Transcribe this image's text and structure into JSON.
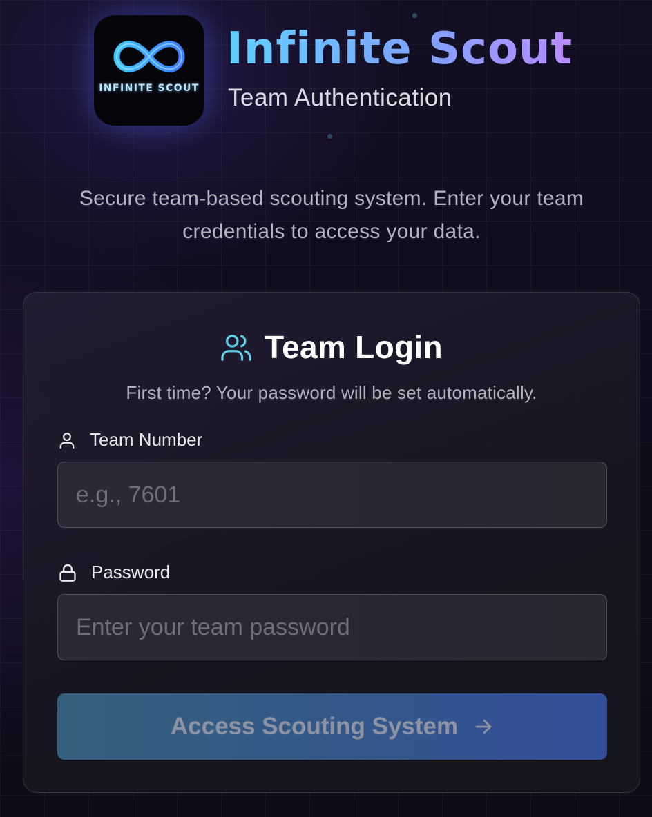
{
  "brand": {
    "logo_text": "INFINITE SCOUT",
    "title": "Infinite Scout",
    "subtitle": "Team Authentication"
  },
  "tagline": "Secure team-based scouting system. Enter your team credentials to access your data.",
  "login_card": {
    "title": "Team Login",
    "title_icon": "users-icon",
    "subtitle": "First time? Your password will be set automatically.",
    "team_number": {
      "label": "Team Number",
      "icon": "user-icon",
      "value": "",
      "placeholder": "e.g., 7601"
    },
    "password": {
      "label": "Password",
      "icon": "lock-icon",
      "value": "",
      "placeholder": "Enter your team password"
    },
    "submit": {
      "label": "Access Scouting System",
      "icon": "arrow-right-icon"
    }
  },
  "colors": {
    "accent_cyan": "#5fd0ff",
    "accent_purple": "#b98bff",
    "button_start": "#34607d",
    "button_end": "#344f9a"
  }
}
